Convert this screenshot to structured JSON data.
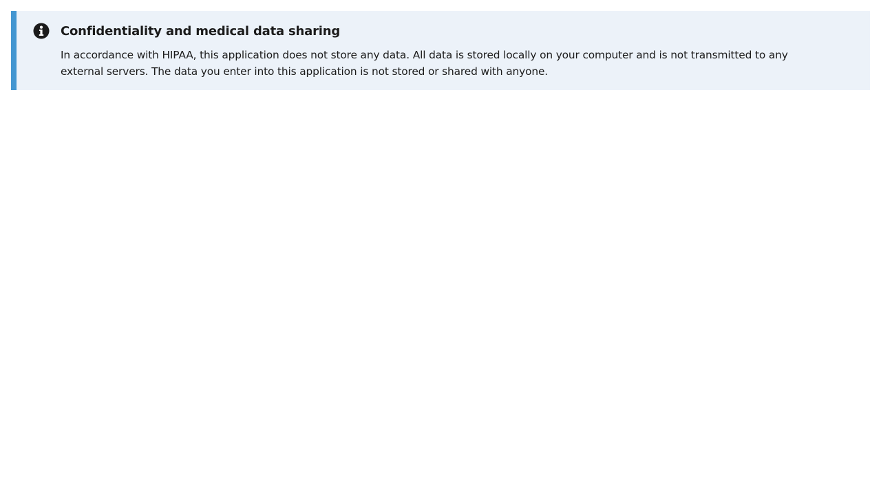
{
  "alert": {
    "type": "info",
    "icon": "info-circle-icon",
    "accent_color": "#4396d1",
    "background_color": "#ecf2f9",
    "heading": "Confidentiality and medical data sharing",
    "text": "In accordance with HIPAA, this application does not store any data. All data is stored locally on your computer and is not transmitted to any external servers. The data you enter into this application is not stored or shared with anyone."
  }
}
